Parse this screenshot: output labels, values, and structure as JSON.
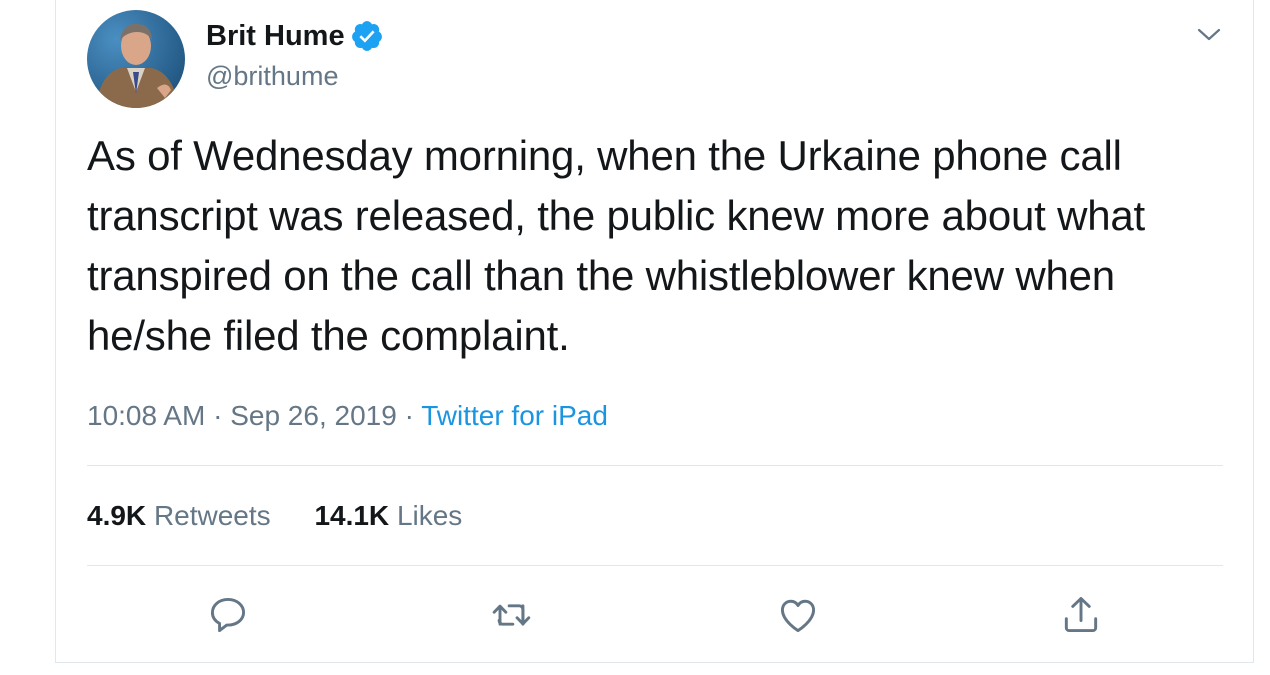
{
  "author": {
    "display_name": "Brit Hume",
    "handle": "@brithume",
    "verified": true
  },
  "tweet": {
    "text": "As of Wednesday morning, when the Urkaine phone call\ntranscript was released, the public knew more about what\ntranspired on the call than the whistleblower knew when\nhe/she filed the complaint.",
    "time": "10:08 AM",
    "separator": "·",
    "date": "Sep 26, 2019",
    "source": "Twitter for iPad"
  },
  "stats": {
    "retweets_count": "4.9K",
    "retweets_label": "Retweets",
    "likes_count": "14.1K",
    "likes_label": "Likes"
  },
  "icons": {
    "verified": "verified-badge-icon",
    "more": "chevron-down-icon",
    "reply": "reply-icon",
    "retweet": "retweet-icon",
    "like": "heart-icon",
    "share": "share-icon"
  },
  "colors": {
    "text_primary": "#14171a",
    "text_secondary": "#657786",
    "link": "#1b95e0",
    "verified_blue": "#1da1f2",
    "border": "#e1e8ed"
  }
}
